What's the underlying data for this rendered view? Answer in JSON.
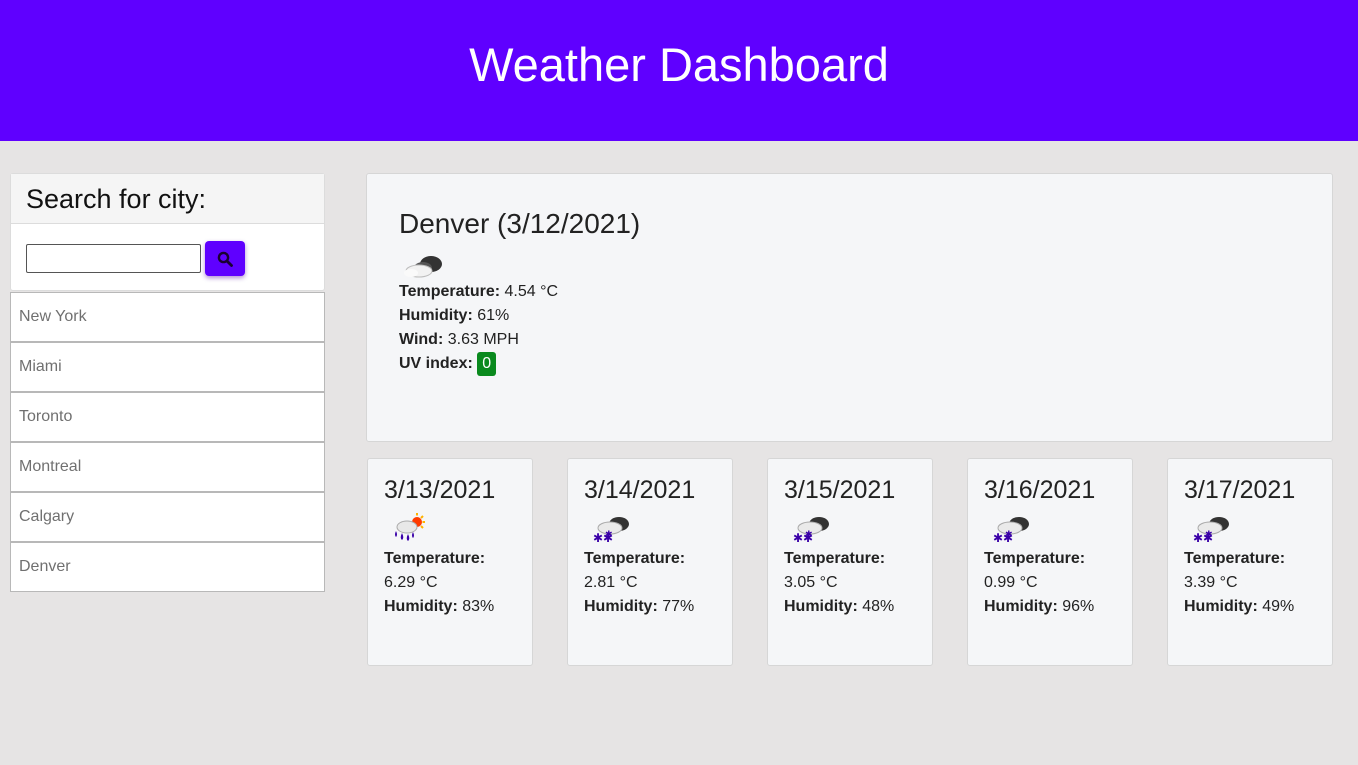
{
  "header": {
    "title": "Weather Dashboard"
  },
  "colors": {
    "brand": "#5f00ff",
    "uv_low": "#0a8a1e"
  },
  "search": {
    "title": "Search for city:",
    "value": "",
    "button_icon": "search-icon"
  },
  "history": [
    "New York",
    "Miami",
    "Toronto",
    "Montreal",
    "Calgary",
    "Denver"
  ],
  "current": {
    "heading": "Denver (3/12/2021)",
    "icon": "cloudy-icon",
    "temperature_label": "Temperature:",
    "temperature": "4.54 °C",
    "humidity_label": "Humidity:",
    "humidity": "61%",
    "wind_label": "Wind:",
    "wind": "3.63 MPH",
    "uv_label": "UV index:",
    "uv": "0"
  },
  "forecast": [
    {
      "date": "3/13/2021",
      "icon": "rain-sun-icon",
      "temperature_label": "Temperature:",
      "temperature": "6.29 °C",
      "humidity_label": "Humidity:",
      "humidity": "83%"
    },
    {
      "date": "3/14/2021",
      "icon": "snow-cloud-icon",
      "temperature_label": "Temperature:",
      "temperature": "2.81 °C",
      "humidity_label": "Humidity:",
      "humidity": "77%"
    },
    {
      "date": "3/15/2021",
      "icon": "snow-cloud-icon",
      "temperature_label": "Temperature:",
      "temperature": "3.05 °C",
      "humidity_label": "Humidity:",
      "humidity": "48%"
    },
    {
      "date": "3/16/2021",
      "icon": "snow-cloud-icon",
      "temperature_label": "Temperature:",
      "temperature": "0.99 °C",
      "humidity_label": "Humidity:",
      "humidity": "96%"
    },
    {
      "date": "3/17/2021",
      "icon": "snow-cloud-icon",
      "temperature_label": "Temperature:",
      "temperature": "3.39 °C",
      "humidity_label": "Humidity:",
      "humidity": "49%"
    }
  ]
}
